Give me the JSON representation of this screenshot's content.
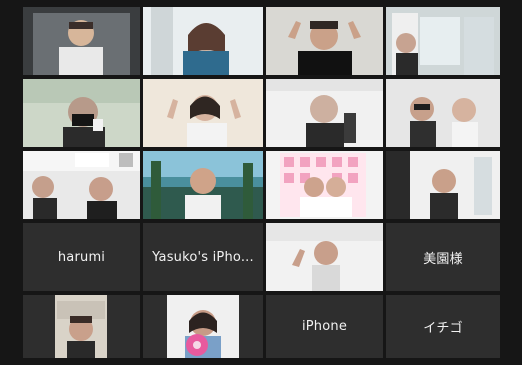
{
  "window": {
    "title": ""
  },
  "participants": [
    {
      "display_name": "",
      "tile": "video"
    },
    {
      "display_name": "",
      "tile": "video"
    },
    {
      "display_name": "",
      "tile": "video"
    },
    {
      "display_name": "",
      "tile": "video"
    },
    {
      "display_name": "",
      "tile": "video"
    },
    {
      "display_name": "",
      "tile": "video"
    },
    {
      "display_name": "",
      "tile": "video"
    },
    {
      "display_name": "",
      "tile": "video"
    },
    {
      "display_name": "",
      "tile": "video"
    },
    {
      "display_name": "",
      "tile": "video"
    },
    {
      "display_name": "",
      "tile": "video"
    },
    {
      "display_name": "",
      "tile": "video"
    },
    {
      "display_name": "harumi",
      "tile": "name"
    },
    {
      "display_name": "Yasuko's iPho...",
      "tile": "name"
    },
    {
      "display_name": "",
      "tile": "video"
    },
    {
      "display_name": "美園様",
      "tile": "name"
    },
    {
      "display_name": "",
      "tile": "video"
    },
    {
      "display_name": "",
      "tile": "video"
    },
    {
      "display_name": "iPhone",
      "tile": "name"
    },
    {
      "display_name": "イチゴ",
      "tile": "name"
    }
  ],
  "colors": {
    "background": "#161616",
    "tile": "#2e2e2e",
    "active_speaker_border": "#c9c35a",
    "name_text": "#f2f2f2"
  }
}
